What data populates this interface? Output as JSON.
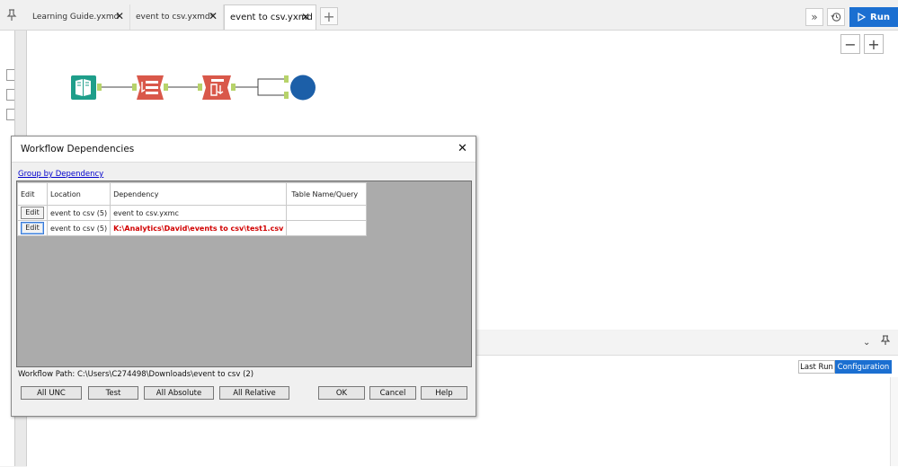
{
  "tabs": [
    {
      "label": "Learning Guide.yxmd",
      "active": false
    },
    {
      "label": "event to csv.yxmd*",
      "active": false
    },
    {
      "label": "event to csv.yxmd",
      "active": true
    }
  ],
  "toolbar": {
    "run_label": "Run"
  },
  "results": {
    "last_run_label": "Last Run",
    "configuration_label": "Configuration"
  },
  "dialog": {
    "title": "Workflow Dependencies",
    "group_link": "Group by Dependency",
    "columns": [
      "Edit",
      "Location",
      "Dependency",
      "Table Name/Query"
    ],
    "rows": [
      {
        "edit": "Edit",
        "location": "event to csv (5)",
        "dependency": "event to csv.yxmc",
        "table": "",
        "missing": false
      },
      {
        "edit": "Edit",
        "location": "event to csv (5)",
        "dependency": "K:\\Analytics\\David\\events to csv\\test1.csv",
        "table": "",
        "missing": true
      }
    ],
    "workflow_path_label": "Workflow Path:",
    "workflow_path": "C:\\Users\\C274498\\Downloads\\event to csv (2)",
    "buttons": {
      "all_unc": "All UNC",
      "test": "Test",
      "all_absolute": "All Absolute",
      "all_relative": "All Relative",
      "ok": "OK",
      "cancel": "Cancel",
      "help": "Help"
    }
  },
  "colors": {
    "accent": "#1b6fd1",
    "error_text": "#d10000",
    "link": "#0000cc",
    "input_tool": "#1e9e8a",
    "transform_tool": "#d9584a",
    "output_tool": "#1c5fa8"
  }
}
